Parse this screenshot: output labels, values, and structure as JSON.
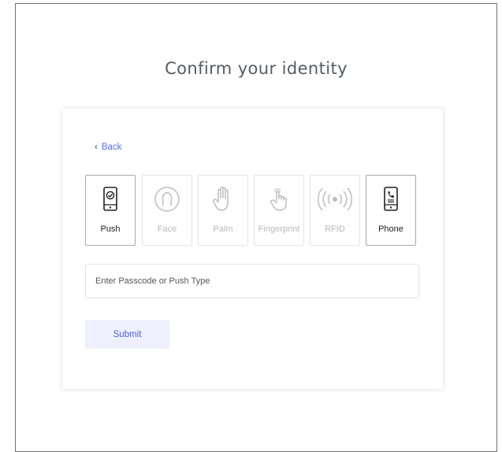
{
  "title": "Confirm your identity",
  "back_label": "Back",
  "methods": [
    {
      "label": "Push",
      "icon": "phone-check-icon",
      "enabled": true
    },
    {
      "label": "Face",
      "icon": "face-icon",
      "enabled": false
    },
    {
      "label": "Palm",
      "icon": "palm-icon",
      "enabled": false
    },
    {
      "label": "Fingerprint",
      "icon": "fingerprint-icon",
      "enabled": false
    },
    {
      "label": "RFID",
      "icon": "rfid-icon",
      "enabled": false
    },
    {
      "label": "Phone",
      "icon": "phone-call-icon",
      "enabled": true
    }
  ],
  "passcode": {
    "placeholder": "Enter Passcode or Push Type",
    "value": ""
  },
  "submit_label": "Submit",
  "colors": {
    "accent": "#5570f2",
    "button_bg": "#eef0fe",
    "title": "#555b63",
    "disabled": "#b8b8b8"
  }
}
